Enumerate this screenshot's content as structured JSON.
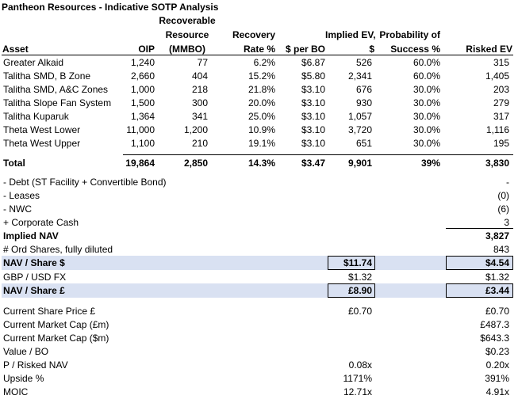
{
  "title": "Pantheon Resources - Indicative SOTP Analysis",
  "headers": {
    "asset": "Asset",
    "oip": "OIP",
    "recoverable": [
      "Recoverable",
      "Resource",
      "(MMBO)"
    ],
    "recovery_rate": [
      "Recovery",
      "Rate %"
    ],
    "per_bo": "$ per BO",
    "implied_ev": [
      "Implied EV,",
      "$"
    ],
    "pos": [
      "Probability of",
      "Success %"
    ],
    "risked_ev": "Risked EV"
  },
  "assets": [
    {
      "name": "Greater Alkaid",
      "oip": "1,240",
      "res": "77",
      "rate": "6.2%",
      "bo": "$6.87",
      "ev": "526",
      "pos": "60.0%",
      "risked": "315"
    },
    {
      "name": "Talitha SMD, B Zone",
      "oip": "2,660",
      "res": "404",
      "rate": "15.2%",
      "bo": "$5.80",
      "ev": "2,341",
      "pos": "60.0%",
      "risked": "1,405"
    },
    {
      "name": "Talitha SMD, A&C Zones",
      "oip": "1,000",
      "res": "218",
      "rate": "21.8%",
      "bo": "$3.10",
      "ev": "676",
      "pos": "30.0%",
      "risked": "203"
    },
    {
      "name": "Talitha Slope Fan System",
      "oip": "1,500",
      "res": "300",
      "rate": "20.0%",
      "bo": "$3.10",
      "ev": "930",
      "pos": "30.0%",
      "risked": "279"
    },
    {
      "name": "Talitha Kuparuk",
      "oip": "1,364",
      "res": "341",
      "rate": "25.0%",
      "bo": "$3.10",
      "ev": "1,057",
      "pos": "30.0%",
      "risked": "317"
    },
    {
      "name": "Theta West Lower",
      "oip": "11,000",
      "res": "1,200",
      "rate": "10.9%",
      "bo": "$3.10",
      "ev": "3,720",
      "pos": "30.0%",
      "risked": "1,116"
    },
    {
      "name": "Theta West Upper",
      "oip": "1,100",
      "res": "210",
      "rate": "19.1%",
      "bo": "$3.10",
      "ev": "651",
      "pos": "30.0%",
      "risked": "195"
    }
  ],
  "total": {
    "name": "Total",
    "oip": "19,864",
    "res": "2,850",
    "rate": "14.3%",
    "bo": "$3.47",
    "ev": "9,901",
    "pos": "39%",
    "risked": "3,830"
  },
  "adjustments": [
    {
      "label": "- Debt (ST Facility + Convertible Bond)",
      "value": "-"
    },
    {
      "label": "- Leases",
      "value": "(0)"
    },
    {
      "label": "- NWC",
      "value": "(6)"
    },
    {
      "label": "+ Corporate Cash",
      "value": "3"
    }
  ],
  "implied_nav": {
    "label": "Implied NAV",
    "value": "3,827"
  },
  "ord_shares": {
    "label": "# Ord Shares, fully diluted",
    "value": "843"
  },
  "nav_share_usd": {
    "label": "NAV / Share $",
    "ev": "$11.74",
    "risked": "$4.54"
  },
  "fx": {
    "label": "GBP / USD FX",
    "ev": "$1.32",
    "risked": "$1.32"
  },
  "nav_share_gbp": {
    "label": "NAV / Share £",
    "ev": "£8.90",
    "risked": "£3.44"
  },
  "metrics": [
    {
      "label": "Current Share Price £",
      "ev": "£0.70",
      "risked": "£0.70"
    },
    {
      "label": "Current Market Cap (£m)",
      "ev": "",
      "risked": "£487.3"
    },
    {
      "label": "Current Market Cap ($m)",
      "ev": "",
      "risked": "$643.3"
    },
    {
      "label": "Value / BO",
      "ev": "",
      "risked": "$0.23"
    },
    {
      "label": "P / Risked NAV",
      "ev": "0.08x",
      "risked": "0.20x"
    },
    {
      "label": "Upside %",
      "ev": "1171%",
      "risked": "391%"
    },
    {
      "label": "MOIC",
      "ev": "12.71x",
      "risked": "4.91x"
    }
  ]
}
